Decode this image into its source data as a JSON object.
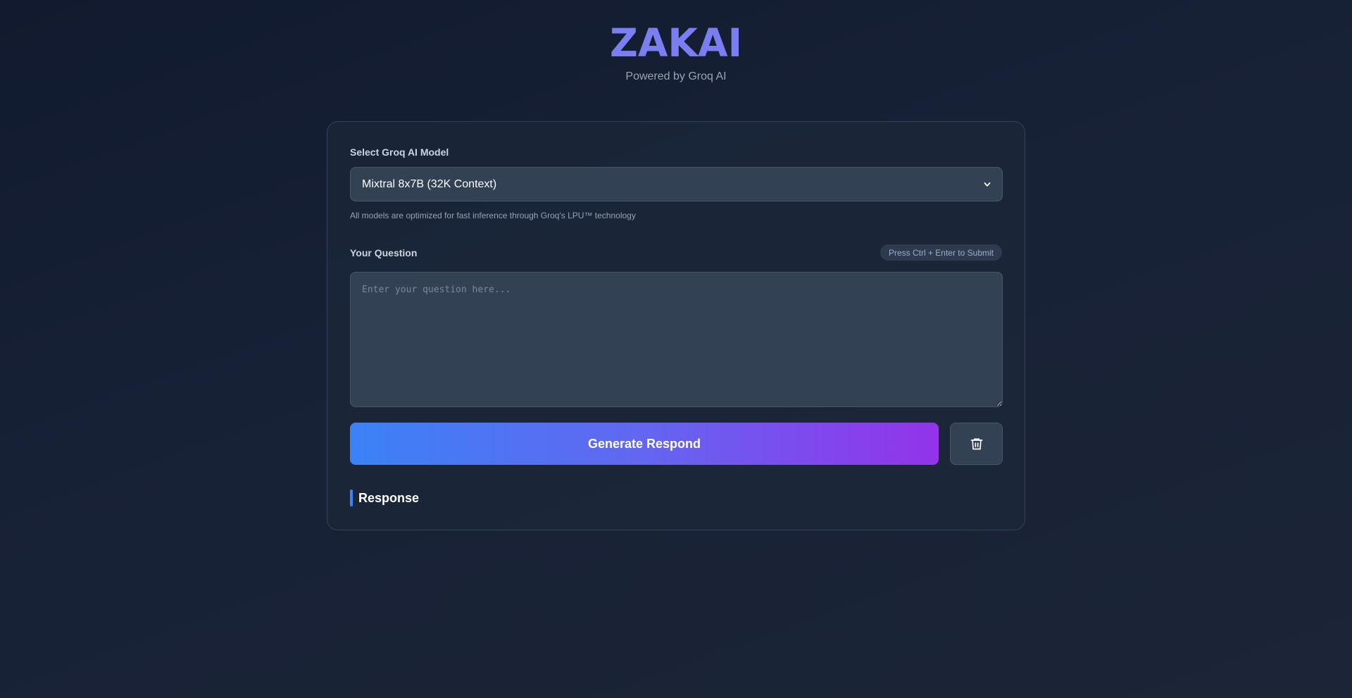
{
  "header": {
    "title": "ZAKAI",
    "subtitle": "Powered by Groq AI"
  },
  "model": {
    "label": "Select Groq AI Model",
    "selected": "Mixtral 8x7B (32K Context)",
    "hint": "All models are optimized for fast inference through Groq's LPU™ technology"
  },
  "question": {
    "label": "Your Question",
    "shortcut_hint": "Press Ctrl + Enter to Submit",
    "placeholder": "Enter your question here...",
    "value": ""
  },
  "actions": {
    "generate_label": "Generate Respond",
    "clear_icon": "trash-icon"
  },
  "response": {
    "title": "Response"
  },
  "colors": {
    "accent_title": "#7b7ef0",
    "gradient_start": "#3b82f6",
    "gradient_end": "#9333ea",
    "response_bar": "#3b82f6"
  }
}
